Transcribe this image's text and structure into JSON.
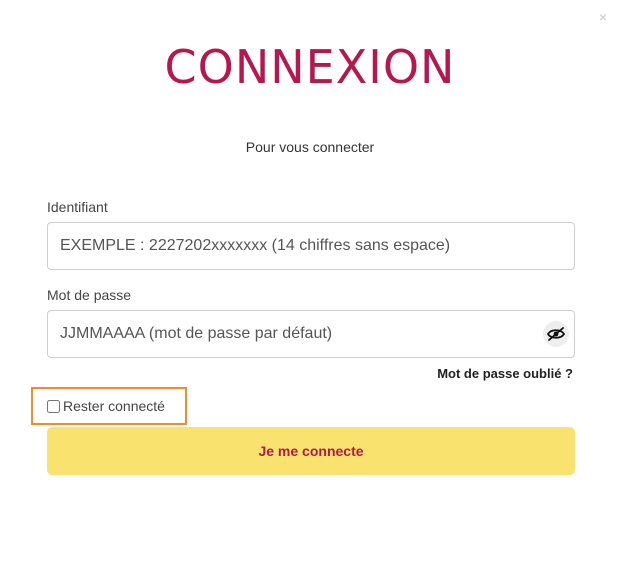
{
  "modal": {
    "close_label": "×",
    "title": "CONNEXION",
    "subtitle": "Pour vous connecter"
  },
  "form": {
    "identifier": {
      "label": "Identifiant",
      "value": "",
      "placeholder": "EXEMPLE : 2227202xxxxxxx (14 chiffres sans espace)"
    },
    "password": {
      "label": "Mot de passe",
      "value": "",
      "placeholder": "JJMMAAAA (mot de passe par défaut)",
      "toggle_icon": "eye-slash-icon"
    },
    "forgot_label": "Mot de passe oublié ?",
    "remember": {
      "label": "Rester connecté",
      "checked": false
    },
    "submit_label": "Je me connecte"
  },
  "colors": {
    "title": "#b5184f",
    "button_bg": "#f9e36e",
    "button_text": "#b5184f",
    "highlight_border": "#f08c2a"
  }
}
